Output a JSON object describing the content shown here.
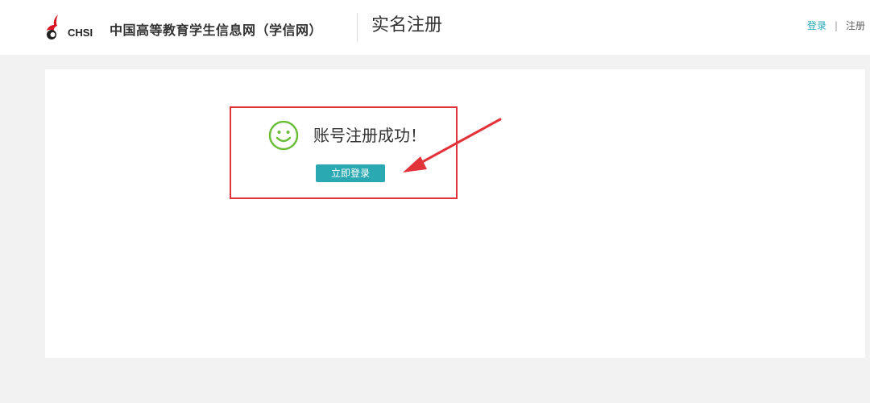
{
  "header": {
    "logo_text": "CHSI",
    "site_name": "中国高等教育学生信息网（学信网）",
    "page_title": "实名注册",
    "links": {
      "login": "登录",
      "separator": "|",
      "register": "注册"
    }
  },
  "main": {
    "success_message": "账号注册成功！",
    "login_button_label": "立即登录"
  },
  "icons": {
    "logo": "chsi-bird-logo-icon",
    "success": "smile-icon",
    "annotation": "red-arrow-icon"
  },
  "colors": {
    "accent": "#2ba9b3",
    "link": "#28a7b5",
    "annotation_red": "#e2333b",
    "smile_green": "#6cbf3a",
    "logo_red": "#d7141f"
  }
}
